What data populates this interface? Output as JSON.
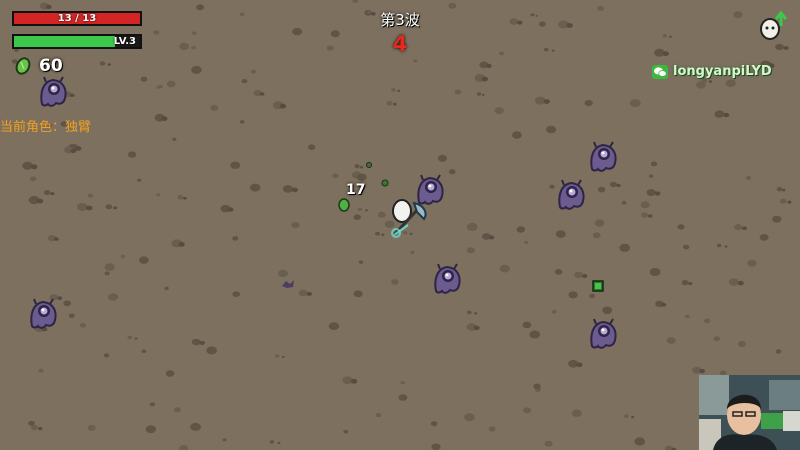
{
  "hud": {
    "hp": {
      "current": 13,
      "max": 13,
      "label": "13 / 13",
      "fill_color": "#d42525"
    },
    "xp": {
      "label": "LV.3",
      "progress": 0.8,
      "fill_color": "#3cc84a"
    },
    "materials": {
      "count": "60",
      "icon": "green-material-icon",
      "color": "#6ac24a"
    },
    "character": {
      "text": "当前角色：独臂"
    },
    "wave": {
      "title": "第3波",
      "timer": "4"
    },
    "levelup_indicator": {
      "icon": "egg-levelup-arrow-icon"
    }
  },
  "game": {
    "damage_number": "17",
    "player": {
      "icon": "white-egg-player-icon",
      "weapon": "battle-axe-icon"
    },
    "enemies": {
      "icon": "purple-baby-alien-icon",
      "color": "#6a5a8c"
    },
    "drops": {
      "icon": "green-material-drop-icon",
      "crate_icon": "loot-crate-icon"
    },
    "ground_color": "#7e705f"
  },
  "overlay": {
    "watermark": {
      "icon": "wechat-icon",
      "text": "longyanpiLYD"
    },
    "webcam": {
      "icon": "streamer-webcam-feed"
    }
  }
}
